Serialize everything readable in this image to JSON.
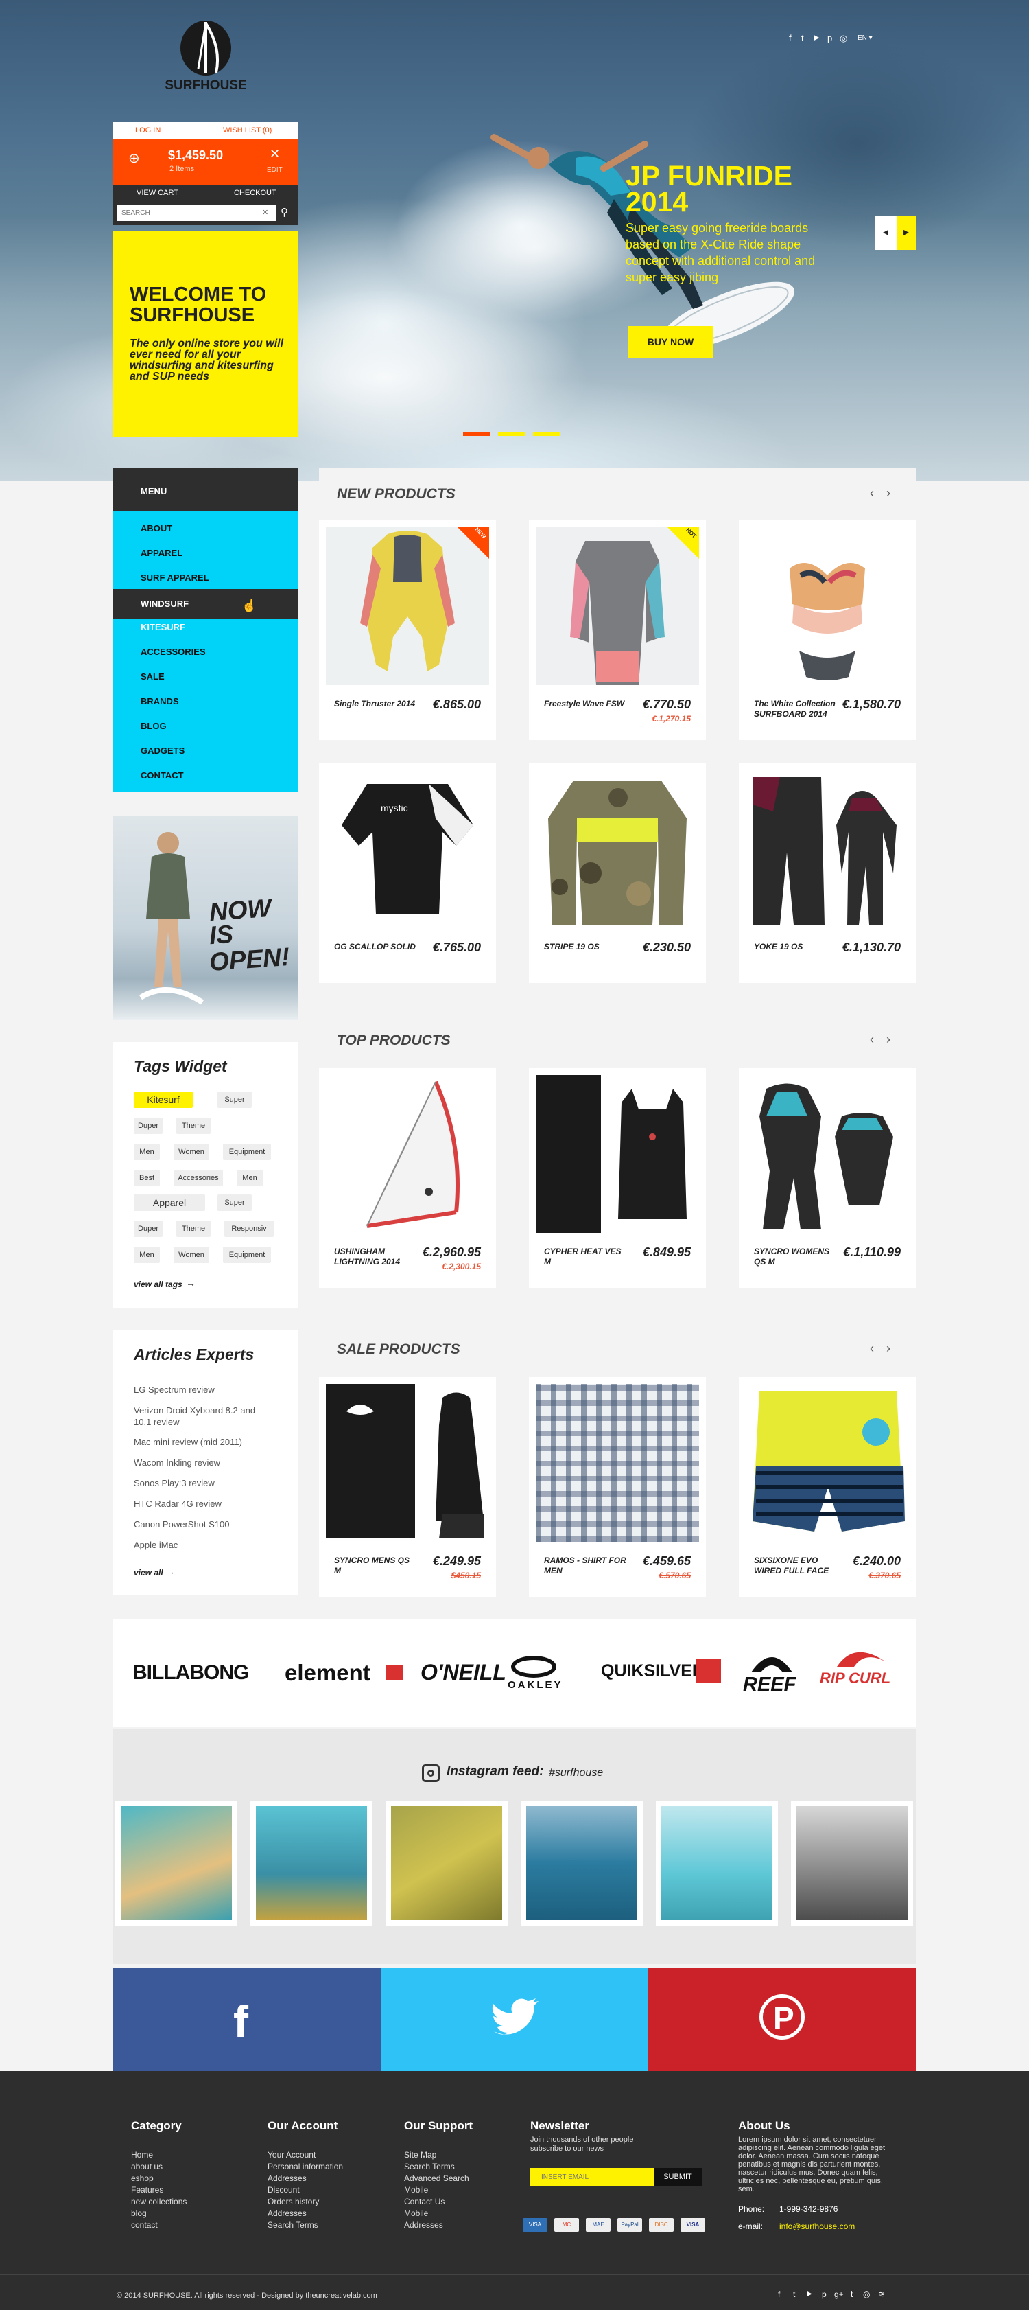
{
  "brand": {
    "name": "SURFHOUSE"
  },
  "top_social": [
    "f",
    "t",
    "▶",
    "p",
    "◎",
    "EN ▾"
  ],
  "account": {
    "login": "LOG IN",
    "wishlist": "WISH LIST (0)"
  },
  "cart": {
    "total": "$1,459.50",
    "items": "2 Items",
    "edit": "EDIT",
    "view": "VIEW CART",
    "checkout": "CHECKOUT"
  },
  "search": {
    "placeholder": "SEARCH"
  },
  "welcome": {
    "title": "WELCOME TO SURFHOUSE",
    "text": "The only online store you will ever need for all your windsurfing and kitesurfing and SUP needs"
  },
  "slide": {
    "title": "JP FUNRIDE 2014",
    "text": "Super easy going freeride boards based on the X-Cite Ride shape concept with additional control and super easy jibing",
    "button": "BUY NOW"
  },
  "menu": {
    "title": "MENU",
    "items": [
      "ABOUT",
      "APPAREL",
      "SURF APPAREL",
      "WINDSURF",
      "KITESURF",
      "ACCESSORIES",
      "SALE",
      "BRANDS",
      "BLOG",
      "GADGETS",
      "CONTACT"
    ]
  },
  "promo": {
    "line1": "NOW",
    "line2": "IS",
    "line3": "OPEN!"
  },
  "tags": {
    "title": "Tags Widget",
    "items": [
      "Kitesurf",
      "Super",
      "Duper",
      "Theme",
      "Men",
      "Women",
      "Equipment",
      "Best",
      "Accessories",
      "Men",
      "Apparel",
      "Super",
      "Duper",
      "Theme",
      "Responsiv",
      "Men",
      "Women",
      "Equipment"
    ],
    "view_all": "view all tags"
  },
  "articles": {
    "title": "Articles Experts",
    "items": [
      "LG Spectrum review",
      "Verizon Droid Xyboard 8.2 and 10.1 review",
      "Mac mini review (mid 2011)",
      "Wacom Inkling review",
      "Sonos Play:3 review",
      "HTC Radar 4G review",
      "Canon PowerShot S100",
      "Apple iMac"
    ],
    "view_all": "view all"
  },
  "new_products": {
    "title": "NEW PRODUCTS",
    "items": [
      {
        "name": "Single Thruster 2014",
        "price": "€.865.00",
        "badge": "NEW"
      },
      {
        "name": "Freestyle Wave FSW",
        "price": "€.770.50",
        "old": "€.1,270.15",
        "badge": "HOT"
      },
      {
        "name": "The White Collection SURFBOARD 2014",
        "price": "€.1,580.70"
      },
      {
        "name": "OG SCALLOP SOLID",
        "price": "€.765.00"
      },
      {
        "name": "STRIPE 19 OS",
        "price": "€.230.50"
      },
      {
        "name": "YOKE 19 OS",
        "price": "€.1,130.70"
      }
    ]
  },
  "top_products": {
    "title": "TOP PRODUCTS",
    "items": [
      {
        "name": "USHINGHAM LIGHTNING 2014",
        "price": "€.2,960.95",
        "old": "€.2,300.15"
      },
      {
        "name": "CYPHER HEAT VES M",
        "price": "€.849.95"
      },
      {
        "name": "SYNCRO WOMENS QS M",
        "price": "€.1,110.99"
      }
    ]
  },
  "sale_products": {
    "title": "SALE PRODUCTS",
    "items": [
      {
        "name": "SYNCRO MENS QS M",
        "price": "€.249.95",
        "old": "$450.15"
      },
      {
        "name": "RAMOS - SHIRT FOR MEN",
        "price": "€.459.65",
        "old": "€.570.65"
      },
      {
        "name": "SIXSIXONE EVO WIRED FULL FACE",
        "price": "€.240.00",
        "old": "€.370.65"
      }
    ]
  },
  "brands": [
    "BILLABONG",
    "element",
    "O'NEILL",
    "OAKLEY",
    "QUIKSILVER",
    "REEF",
    "RIP CURL"
  ],
  "instagram": {
    "title": "Instagram feed:",
    "handle": "#surfhouse"
  },
  "social_bar": {
    "facebook": "f",
    "pinterest": "P"
  },
  "footer": {
    "category": {
      "title": "Category",
      "links": [
        "Home",
        "about us",
        "eshop",
        "Features",
        "new collections",
        "blog",
        "contact"
      ]
    },
    "account": {
      "title": "Our Account",
      "links": [
        "Your Account",
        "Personal information",
        "Addresses",
        "Discount",
        "Orders history",
        "Addresses",
        "Search Terms"
      ]
    },
    "support": {
      "title": "Our Support",
      "links": [
        "Site Map",
        "Search Terms",
        "Advanced Search",
        "Mobile",
        "Contact Us",
        "Mobile",
        "Addresses"
      ]
    },
    "newsletter": {
      "title": "Newsletter",
      "text": "Join thousands of other people subscribe to our news",
      "placeholder": "INSERT EMAIL",
      "button": "SUBMIT"
    },
    "payments": [
      "VISA",
      "MC",
      "MAE",
      "PayPal",
      "DISC",
      "VISA"
    ],
    "about": {
      "title": "About Us",
      "text": "Lorem ipsum dolor sit amet, consectetuer adipiscing elit. Aenean commodo ligula eget dolor. Aenean massa. Cum sociis natoque penatibus et magnis dis parturient montes, nascetur ridiculus mus. Donec quam felis, ultricies nec, pellentesque eu, pretium quis, sem.",
      "phone_label": "Phone:",
      "phone": "1-999-342-9876",
      "email_label": "e-mail:",
      "email": "info@surfhouse.com"
    },
    "copyright": "© 2014  SURFHOUSE. All rights reserved - Designed by theuncreativelab.com",
    "social": [
      "f",
      "t",
      "▶",
      "p",
      "g+",
      "t",
      "◎",
      "≋"
    ]
  },
  "colors": {
    "yellow": "#fff200",
    "cyan": "#00d2f8",
    "orange": "#ff4800",
    "dark": "#2e2e2e",
    "facebook": "#3b5998",
    "twitter": "#2fc2f6",
    "pinterest": "#cb2128"
  }
}
